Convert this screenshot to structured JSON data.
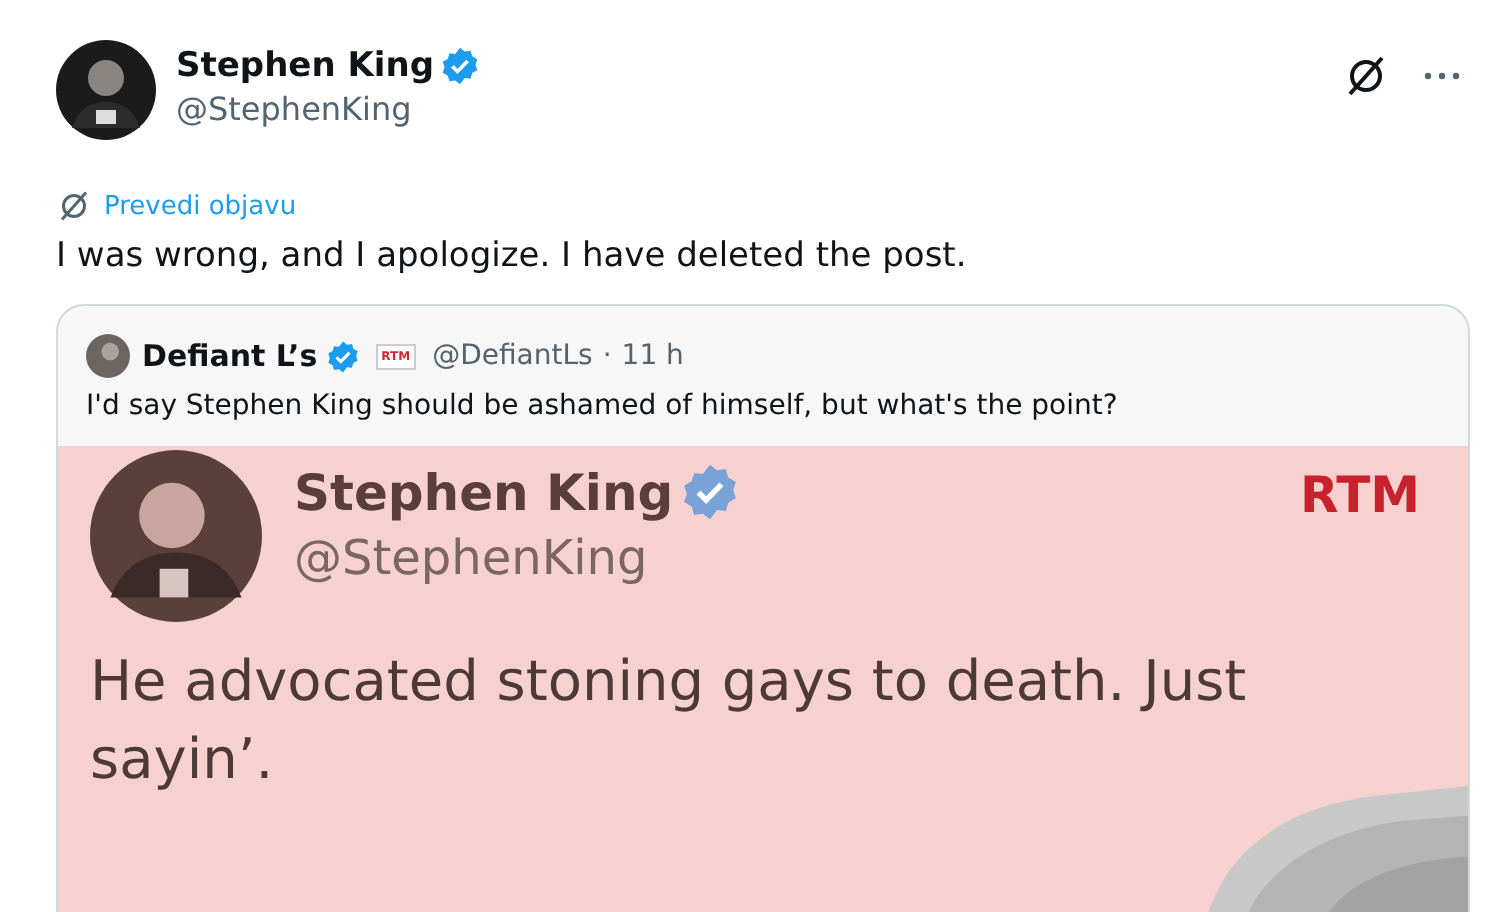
{
  "post": {
    "author": {
      "name": "Stephen King",
      "verified": true,
      "handle": "@StephenKing"
    },
    "translate_link": "Prevedi objavu",
    "text": "I was wrong, and I apologize. I have deleted the post.",
    "quote": {
      "author": {
        "name": "Defiant L’s",
        "verified": true,
        "affiliate_badge": "RTM",
        "handle": "@DefiantLs",
        "separator": "·",
        "time": "11 h"
      },
      "text": "I'd say Stephen King should be ashamed of himself, but what's the point?",
      "media": {
        "author": {
          "name": "Stephen King",
          "verified": true,
          "handle": "@StephenKing"
        },
        "logo": "RTM",
        "text": "He advocated stoning gays to death. Just sayin’."
      }
    }
  }
}
